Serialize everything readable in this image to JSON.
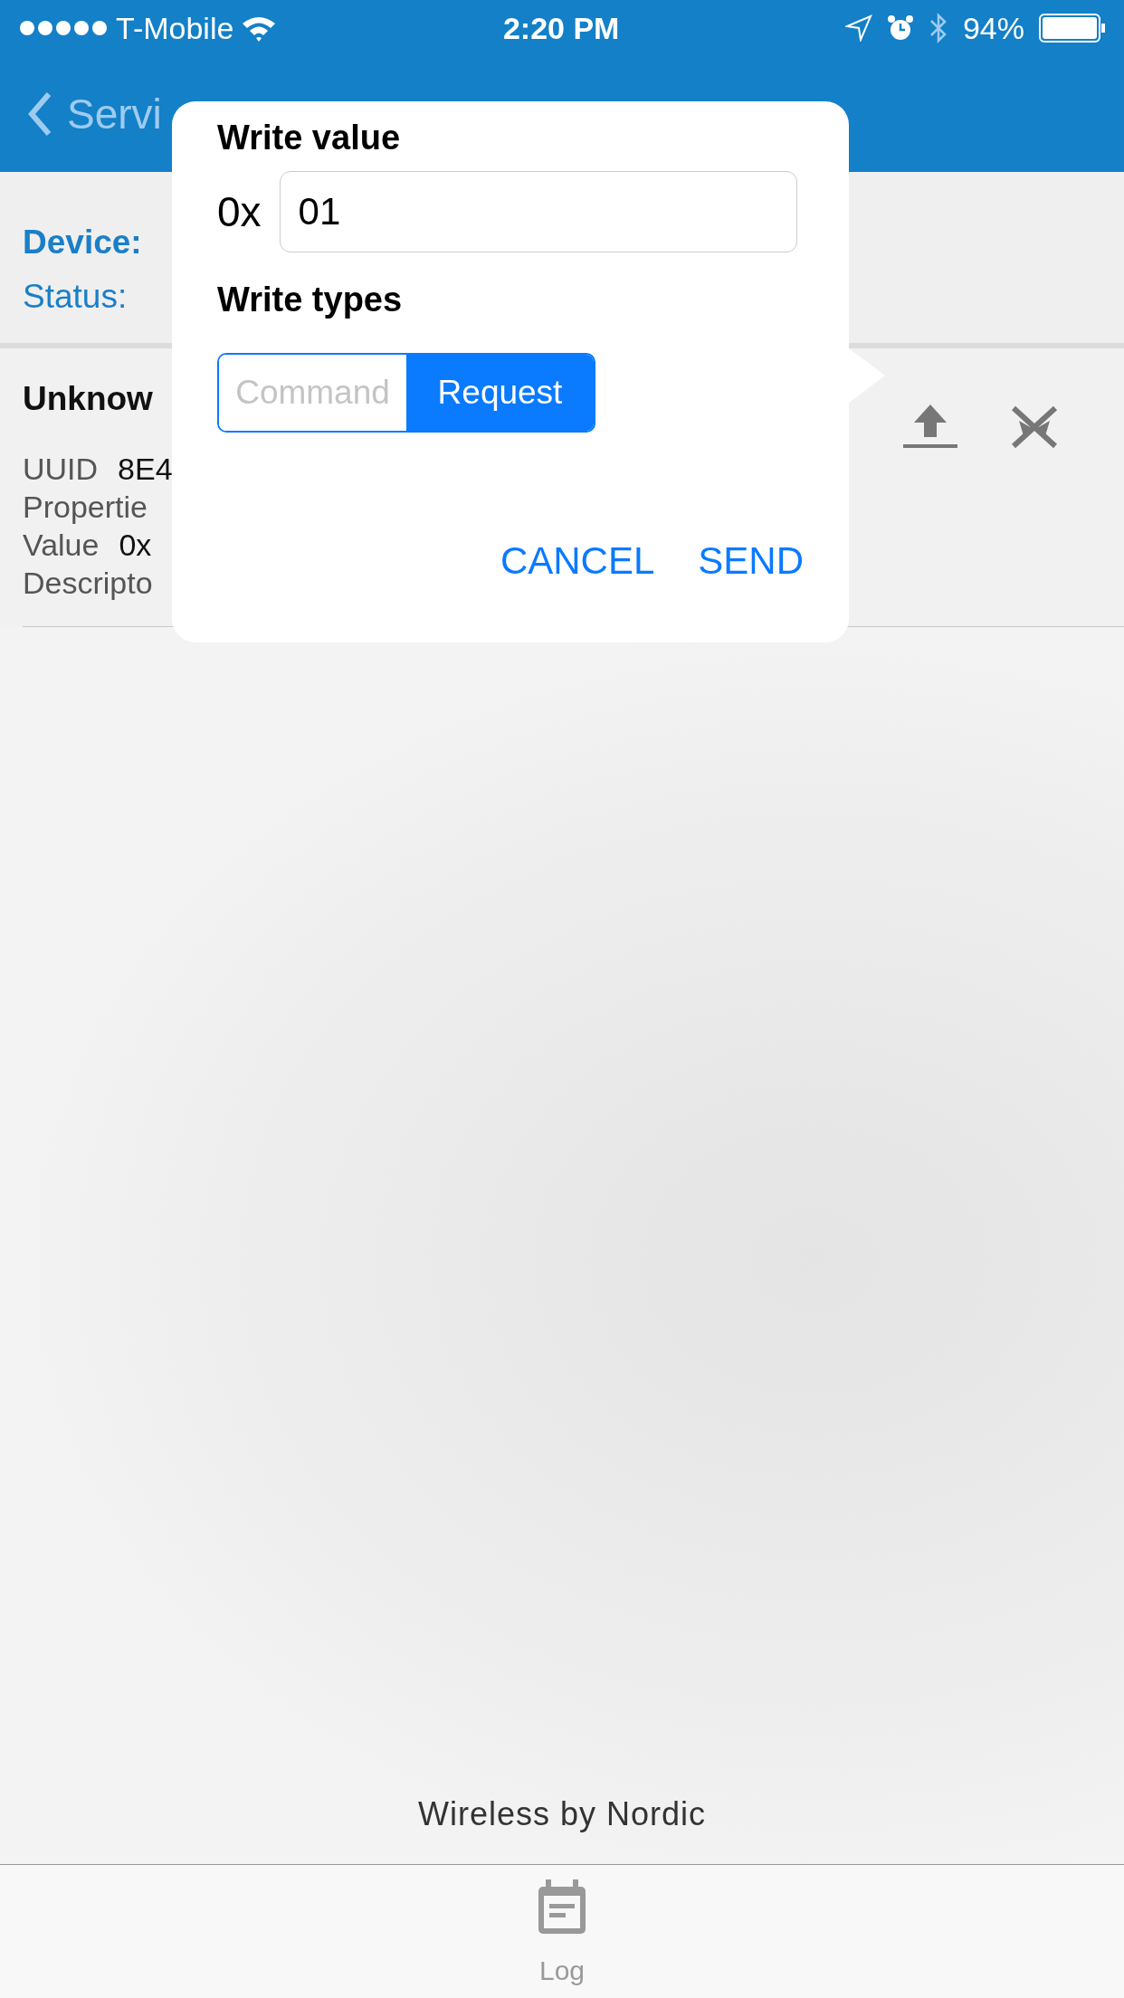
{
  "status_bar": {
    "carrier": "T-Mobile",
    "time": "2:20 PM",
    "battery": "94%"
  },
  "nav": {
    "back_label": "Servi"
  },
  "device_panel": {
    "device_label": "Device:",
    "status_label": "Status:"
  },
  "characteristic": {
    "name": "Unknow",
    "fields": [
      {
        "label": "UUID",
        "value": "8E4"
      },
      {
        "label": "Propertie"
      },
      {
        "label": "Value",
        "value": "0x"
      },
      {
        "label": "Descripto"
      }
    ]
  },
  "dialog": {
    "title": "Write value",
    "prefix": "0x",
    "value": "01",
    "types_label": "Write types",
    "types": [
      {
        "label": "Command",
        "selected": false
      },
      {
        "label": "Request",
        "selected": true
      }
    ],
    "buttons": [
      "CANCEL",
      "SEND"
    ]
  },
  "footer": "Wireless by Nordic",
  "tab_bar": [
    {
      "label": "Log"
    }
  ]
}
